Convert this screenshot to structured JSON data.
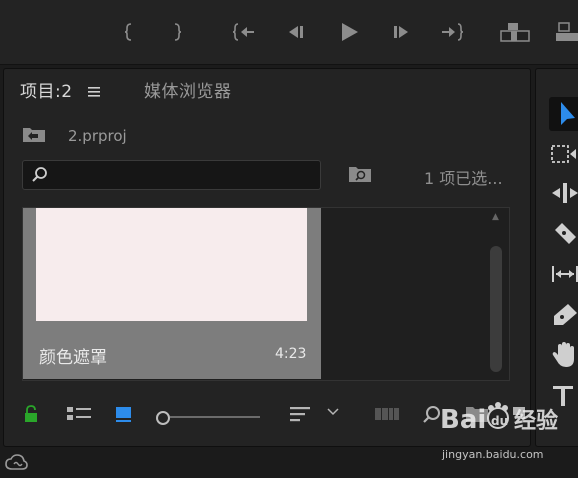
{
  "project_panel": {
    "tab_project": "项目:2",
    "tab_menu_icon": "hamburger-icon",
    "tab_media_browser": "媒体浏览器",
    "project_file": "2.prproj",
    "search": {
      "value": "",
      "placeholder": ""
    },
    "selection_count": "1 项已选...",
    "clip": {
      "name": "颜色遮罩",
      "duration": "4:23",
      "thumb_color": "#f7eced"
    }
  },
  "watermark": {
    "logo": "Bai du 经验",
    "url": "jingyan.baidu.com"
  },
  "colors": {
    "accent": "#2d8ceb",
    "lock_green": "#2aa62a",
    "panel_bg": "#232323",
    "list_view_blue": "#2d8ceb"
  }
}
